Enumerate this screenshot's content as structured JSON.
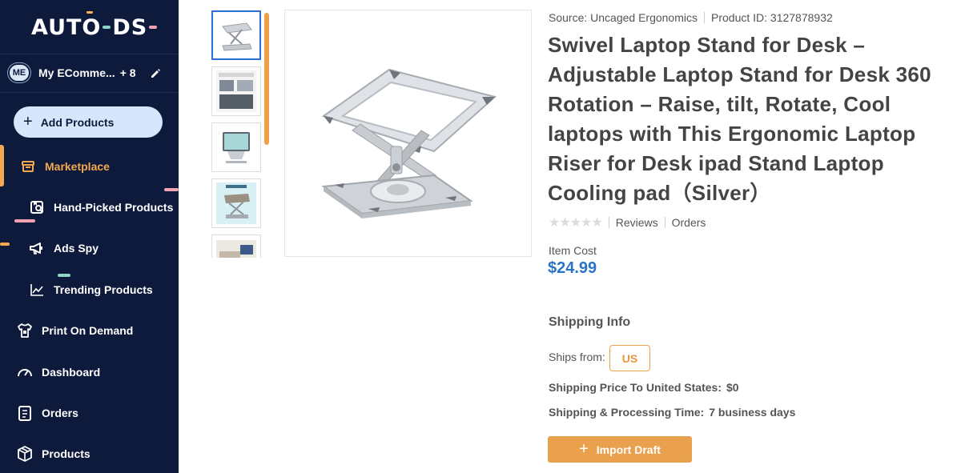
{
  "sidebar": {
    "logo": {
      "part1": "AUT",
      "part2": "O",
      "part3": "DS"
    },
    "store": {
      "badge": "ME",
      "name": "My EComme...",
      "extra": "+ 8"
    },
    "add_products_label": "Add Products",
    "items": [
      {
        "label": "Marketplace",
        "icon": "store-icon",
        "active": true
      },
      {
        "label": "Hand-Picked Products",
        "icon": "hand-picked-icon"
      },
      {
        "label": "Ads Spy",
        "icon": "megaphone-icon"
      },
      {
        "label": "Trending Products",
        "icon": "trend-icon"
      },
      {
        "label": "Print On Demand",
        "icon": "shirt-icon"
      },
      {
        "label": "Dashboard",
        "icon": "gauge-icon"
      },
      {
        "label": "Orders",
        "icon": "clipboard-icon"
      },
      {
        "label": "Products",
        "icon": "box-icon"
      }
    ]
  },
  "product": {
    "source": "Source: Uncaged Ergonomics",
    "product_id": "Product ID: 3127878932",
    "title": "Swivel Laptop Stand for Desk – Adjustable Laptop Stand for Desk 360 Rotation – Raise, tilt, Rotate, Cool laptops with This Ergonomic Laptop Riser for Desk ipad Stand Laptop Cooling pad（Silver）",
    "reviews_label": "Reviews",
    "orders_label": "Orders",
    "rating": 0,
    "item_cost_label": "Item Cost",
    "price": "$24.99"
  },
  "shipping": {
    "title": "Shipping Info",
    "ships_from_label": "Ships from:",
    "country": "US",
    "price_label": "Shipping Price To United States:",
    "price_value": "$0",
    "time_label": "Shipping & Processing Time:",
    "time_value": "7 business days"
  },
  "actions": {
    "import_label": "Import Draft"
  },
  "colors": {
    "sidebar_bg": "#0e1a3c",
    "accent": "#f5a94e",
    "price": "#2a74c8",
    "thumb_selected": "#2a6fd6"
  }
}
